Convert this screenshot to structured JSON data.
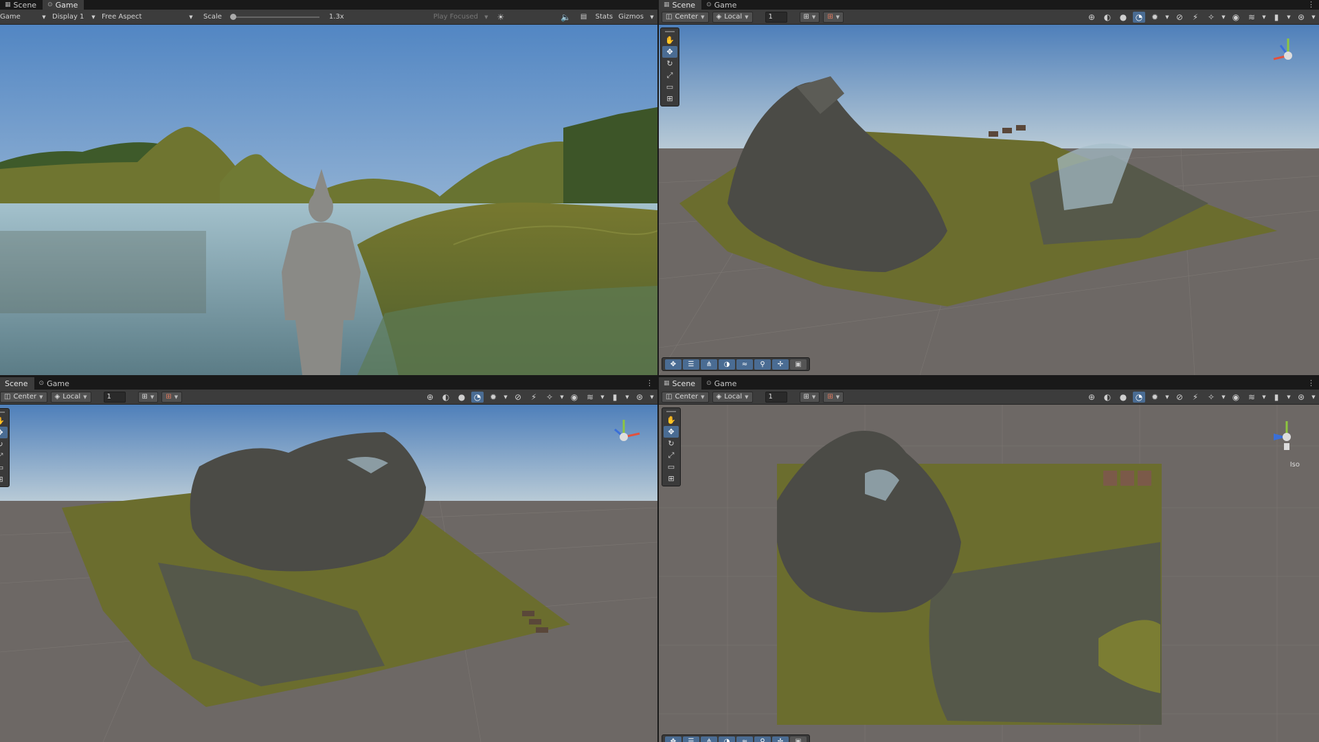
{
  "game": {
    "tabs": [
      {
        "label": "Scene",
        "icon": "grid-icon"
      },
      {
        "label": "Game",
        "icon": "gamepad-icon"
      }
    ],
    "display_mode": "Game",
    "display": "Display 1",
    "aspect": "Free Aspect",
    "scale_label": "Scale",
    "scale_value": "1.3x",
    "play_focused": "Play Focused",
    "stats_label": "Stats",
    "gizmos_label": "Gizmos"
  },
  "scene_toolbar": {
    "pivot": "Center",
    "space": "Local",
    "snap_increment": "1"
  },
  "scene_tabs": [
    {
      "label": "Scene",
      "icon": "grid-icon"
    },
    {
      "label": "Game",
      "icon": "gamepad-icon"
    }
  ],
  "iso_label": "Iso",
  "colors": {
    "accent": "#4a6c93",
    "panel": "#3c3c3c",
    "tabbar": "#191919",
    "sky_top": "#4d7fbd",
    "sky_horizon": "#c3d4e0",
    "ground": "#6b6663",
    "terrain_grass": "#6d6e2c",
    "terrain_rock": "#4b4b46",
    "water": "#5b8a9a"
  },
  "tool_icons": [
    "hand-tool-icon",
    "move-tool-icon",
    "rotate-tool-icon",
    "scale-tool-icon",
    "rect-tool-icon",
    "transform-tool-icon"
  ],
  "overlay_icons": [
    "move-icon",
    "terrain-icon",
    "grass-icon",
    "sky-icon",
    "water-icon",
    "search-icon",
    "pivot-icon",
    "camera-icon"
  ]
}
